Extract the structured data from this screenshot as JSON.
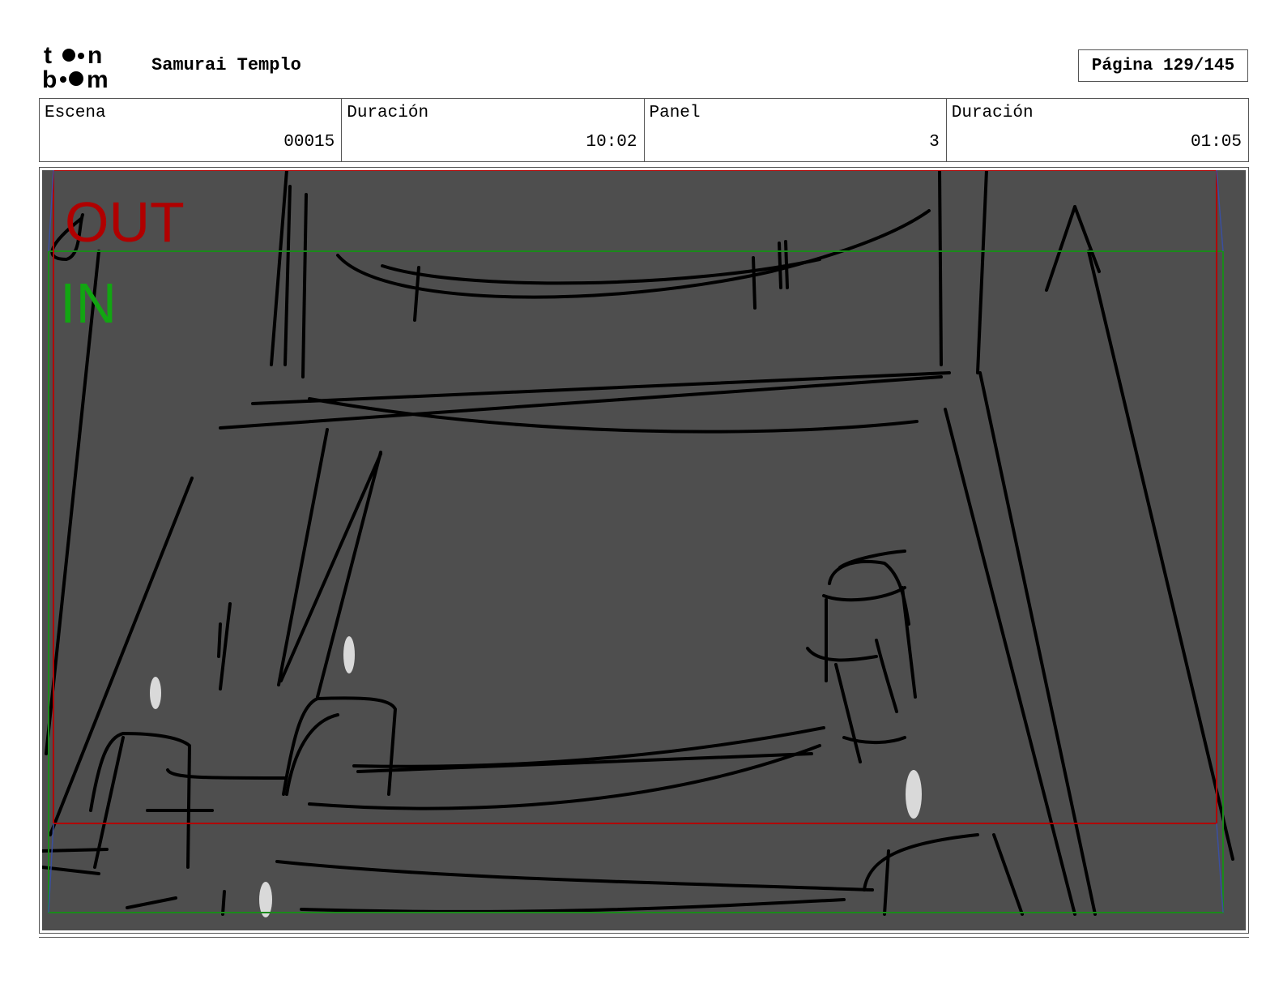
{
  "header": {
    "logo_text": "toon boom",
    "project_title": "Samurai Templo",
    "page_label": "Página 129/145"
  },
  "info": {
    "scene_label": "Escena",
    "scene_value": "00015",
    "scene_duration_label": "Duración",
    "scene_duration_value": "10:02",
    "panel_label": "Panel",
    "panel_value": "3",
    "panel_duration_label": "Duración",
    "panel_duration_value": "01:05"
  },
  "panel": {
    "out_label": "OUT",
    "in_label": "IN",
    "colors": {
      "background": "#4e4e4e",
      "out_frame": "#b00000",
      "in_frame": "#1a8a1a",
      "sketch": "#000000",
      "highlight": "#d9d9d9"
    }
  }
}
